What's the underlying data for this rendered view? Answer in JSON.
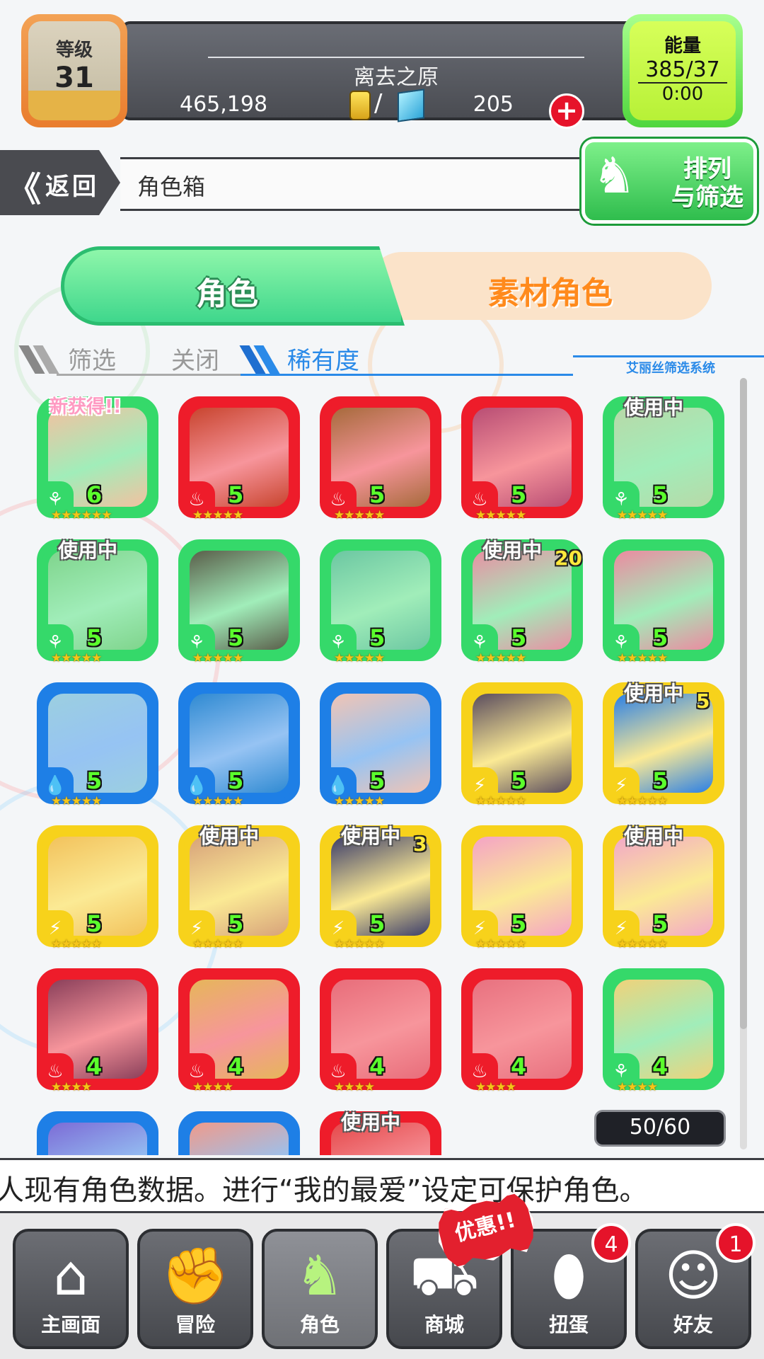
{
  "hud": {
    "level_label": "等级",
    "level_value": "31",
    "location": "离去之原",
    "gold": "465,198",
    "divider": "/",
    "gems": "205",
    "energy_label": "能量",
    "energy_value": "385/37",
    "energy_timer": "0:00"
  },
  "header": {
    "back_chevron": "《",
    "back_label": "返回",
    "title": "角色箱",
    "sort_label_line1": "排列",
    "sort_label_line2": "与筛选"
  },
  "tabs": {
    "active": "角色",
    "inactive": "素材角色"
  },
  "filter": {
    "filter_label": "筛选",
    "filter_value": "关闭",
    "sort_label": "稀有度",
    "system_label": "艾丽丝筛选系统"
  },
  "colors": {
    "green": "#35d96a",
    "red": "#ee1c2a",
    "blue": "#1e7fe6",
    "yellow": "#f7d21b"
  },
  "cards": [
    {
      "element": "green",
      "level": "6",
      "stars": "★★★★★★",
      "badge": "新获得!!",
      "bonus": "",
      "portrait": "#f3c1a0"
    },
    {
      "element": "red",
      "level": "5",
      "stars": "★★★★★",
      "badge": "",
      "bonus": "",
      "portrait": "#c8442e"
    },
    {
      "element": "red",
      "level": "5",
      "stars": "★★★★★",
      "badge": "",
      "bonus": "",
      "portrait": "#a66a3b"
    },
    {
      "element": "red",
      "level": "5",
      "stars": "★★★★★",
      "badge": "",
      "bonus": "",
      "portrait": "#b84d74"
    },
    {
      "element": "green",
      "level": "5",
      "stars": "★★★★★",
      "badge": "使用中",
      "bonus": "",
      "portrait": "#b8d9a8"
    },
    {
      "element": "green",
      "level": "5",
      "stars": "★★★★★",
      "badge": "使用中",
      "bonus": "",
      "portrait": "#7fd48c"
    },
    {
      "element": "green",
      "level": "5",
      "stars": "★★★★★",
      "badge": "",
      "bonus": "",
      "portrait": "#5a5e4a"
    },
    {
      "element": "green",
      "level": "5",
      "stars": "★★★★★",
      "badge": "",
      "bonus": "",
      "portrait": "#6cc7a2"
    },
    {
      "element": "green",
      "level": "5",
      "stars": "★★★★★",
      "badge": "使用中",
      "bonus": "20",
      "portrait": "#e98fa3"
    },
    {
      "element": "green",
      "level": "5",
      "stars": "★★★★★",
      "badge": "",
      "bonus": "",
      "portrait": "#ec8aa0"
    },
    {
      "element": "blue",
      "level": "5",
      "stars": "★★★★★",
      "badge": "",
      "bonus": "",
      "portrait": "#9ccfe0"
    },
    {
      "element": "blue",
      "level": "5",
      "stars": "★★★★★",
      "badge": "",
      "bonus": "",
      "portrait": "#2f8ad2"
    },
    {
      "element": "blue",
      "level": "5",
      "stars": "★★★★★",
      "badge": "",
      "bonus": "",
      "portrait": "#f1c4b4"
    },
    {
      "element": "yellow",
      "level": "5",
      "stars": "★★★★★",
      "badge": "",
      "bonus": "",
      "portrait": "#5a4c5e"
    },
    {
      "element": "yellow",
      "level": "5",
      "stars": "★★★★★",
      "badge": "使用中",
      "bonus": "5",
      "portrait": "#2a7fe6"
    },
    {
      "element": "yellow",
      "level": "5",
      "stars": "★★★★★",
      "badge": "",
      "bonus": "",
      "portrait": "#f2c25c"
    },
    {
      "element": "yellow",
      "level": "5",
      "stars": "★★★★★",
      "badge": "使用中",
      "bonus": "",
      "portrait": "#d7a27a"
    },
    {
      "element": "yellow",
      "level": "5",
      "stars": "★★★★★",
      "badge": "使用中",
      "bonus": "3",
      "portrait": "#3c3d6a"
    },
    {
      "element": "yellow",
      "level": "5",
      "stars": "★★★★★",
      "badge": "",
      "bonus": "",
      "portrait": "#f4a3c6"
    },
    {
      "element": "yellow",
      "level": "5",
      "stars": "★★★★★",
      "badge": "使用中",
      "bonus": "",
      "portrait": "#f2a8c8"
    },
    {
      "element": "red",
      "level": "4",
      "stars": "★★★★",
      "badge": "",
      "bonus": "",
      "portrait": "#8a3f5a"
    },
    {
      "element": "red",
      "level": "4",
      "stars": "★★★★",
      "badge": "",
      "bonus": "",
      "portrait": "#e6b65a"
    },
    {
      "element": "red",
      "level": "4",
      "stars": "★★★★",
      "badge": "",
      "bonus": "",
      "portrait": "#e86d7a"
    },
    {
      "element": "red",
      "level": "4",
      "stars": "★★★★",
      "badge": "",
      "bonus": "",
      "portrait": "#e8717f"
    },
    {
      "element": "green",
      "level": "4",
      "stars": "★★★★",
      "badge": "",
      "bonus": "",
      "portrait": "#f0d27a"
    },
    {
      "element": "blue",
      "level": "",
      "stars": "",
      "badge": "",
      "bonus": "",
      "portrait": "#7c6bd6"
    },
    {
      "element": "blue",
      "level": "",
      "stars": "",
      "badge": "",
      "bonus": "",
      "portrait": "#f09a8a"
    },
    {
      "element": "red",
      "level": "",
      "stars": "",
      "badge": "使用中",
      "bonus": "",
      "portrait": "#e5484a"
    }
  ],
  "count": "50/60",
  "ticker": "人现有角色数据。进行“我的最爱”设定可保护角色。",
  "nav": {
    "home": "主画面",
    "adventure": "冒险",
    "characters": "角色",
    "shop": "商城",
    "gacha": "扭蛋",
    "gacha_badge": "4",
    "friends": "好友",
    "friends_badge": "1",
    "promo": "优惠!!"
  }
}
